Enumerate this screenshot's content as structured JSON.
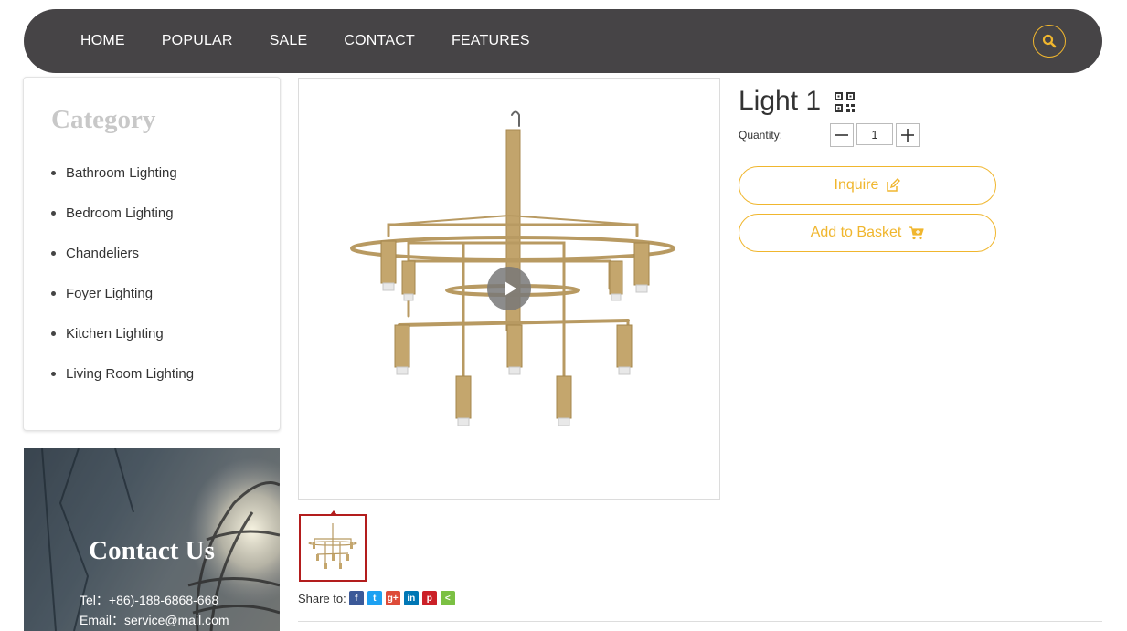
{
  "nav": {
    "items": [
      "HOME",
      "POPULAR",
      "SALE",
      "CONTACT",
      "FEATURES"
    ],
    "search_icon": "search-icon"
  },
  "sidebar": {
    "category_title": "Category",
    "categories": [
      "Bathroom Lighting",
      "Bedroom Lighting",
      "Chandeliers",
      "Foyer Lighting",
      "Kitchen Lighting",
      "Living Room Lighting"
    ],
    "contact": {
      "title": "Contact Us",
      "tel": "Tel：+86)-188-6868-668",
      "email": "Email：service@mail.com"
    }
  },
  "product": {
    "title": "Light 1",
    "quantity_label": "Quantity:",
    "quantity_value": "1",
    "inquire_label": "Inquire",
    "basket_label": "Add to Basket"
  },
  "share": {
    "label": "Share to:",
    "networks": [
      {
        "name": "facebook",
        "glyph": "f",
        "color": "#3b5998"
      },
      {
        "name": "twitter",
        "glyph": "t",
        "color": "#1da1f2"
      },
      {
        "name": "google-plus",
        "glyph": "g+",
        "color": "#dd4b39"
      },
      {
        "name": "linkedin",
        "glyph": "in",
        "color": "#0077b5"
      },
      {
        "name": "pinterest",
        "glyph": "p",
        "color": "#cb2027"
      },
      {
        "name": "share",
        "glyph": "<",
        "color": "#7bc043"
      }
    ]
  },
  "colors": {
    "accent": "#f0b62e",
    "nav_bg": "#464446",
    "thumb_border": "#b31d1d"
  }
}
